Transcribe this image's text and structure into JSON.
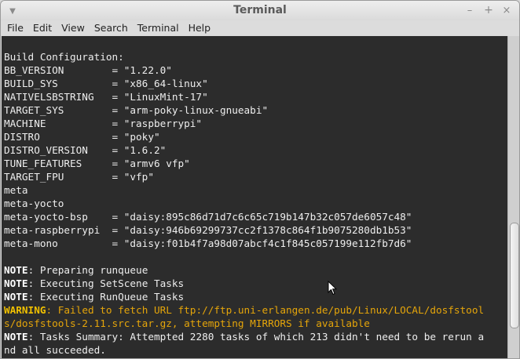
{
  "window": {
    "title": "Terminal",
    "controls": {
      "minimize": "–",
      "maximize": "+",
      "close": "×"
    }
  },
  "menubar": {
    "items": [
      "File",
      "Edit",
      "View",
      "Search",
      "Terminal",
      "Help"
    ]
  },
  "terminal": {
    "build_header": "Build Configuration:",
    "config": [
      "BB_VERSION        = \"1.22.0\"",
      "BUILD_SYS         = \"x86_64-linux\"",
      "NATIVELSBSTRING   = \"LinuxMint-17\"",
      "TARGET_SYS        = \"arm-poky-linux-gnueabi\"",
      "MACHINE           = \"raspberrypi\"",
      "DISTRO            = \"poky\"",
      "DISTRO_VERSION    = \"1.6.2\"",
      "TUNE_FEATURES     = \"armv6 vfp\"",
      "TARGET_FPU        = \"vfp\"",
      "meta",
      "meta-yocto",
      "meta-yocto-bsp    = \"daisy:895c86d71d7c6c65c719b147b32c057de6057c48\"",
      "meta-raspberrypi  = \"daisy:946b69299737cc2f1378c864f1b9075280db1b53\"",
      "meta-mono         = \"daisy:f01b4f7a98d07abcf4c1f845c057199e112fb7d6\""
    ],
    "note_label": "NOTE",
    "warning_label": "WARNING",
    "notes": [
      ": Preparing runqueue",
      ": Executing SetScene Tasks",
      ": Executing RunQueue Tasks"
    ],
    "warning_line1": ": Failed to fetch URL ftp://ftp.uni-erlangen.de/pub/Linux/LOCAL/dosfstool",
    "warning_line2": "s/dosfstools-2.11.src.tar.gz, attempting MIRRORS if available",
    "summary_line1": ": Tasks Summary: Attempted 2280 tasks of which 213 didn't need to be rerun a",
    "summary_line2": "nd all succeeded."
  },
  "colors": {
    "terminal_bg": "#2c2c2c",
    "terminal_fg": "#eeeeee",
    "warning": "#e5a50a"
  }
}
